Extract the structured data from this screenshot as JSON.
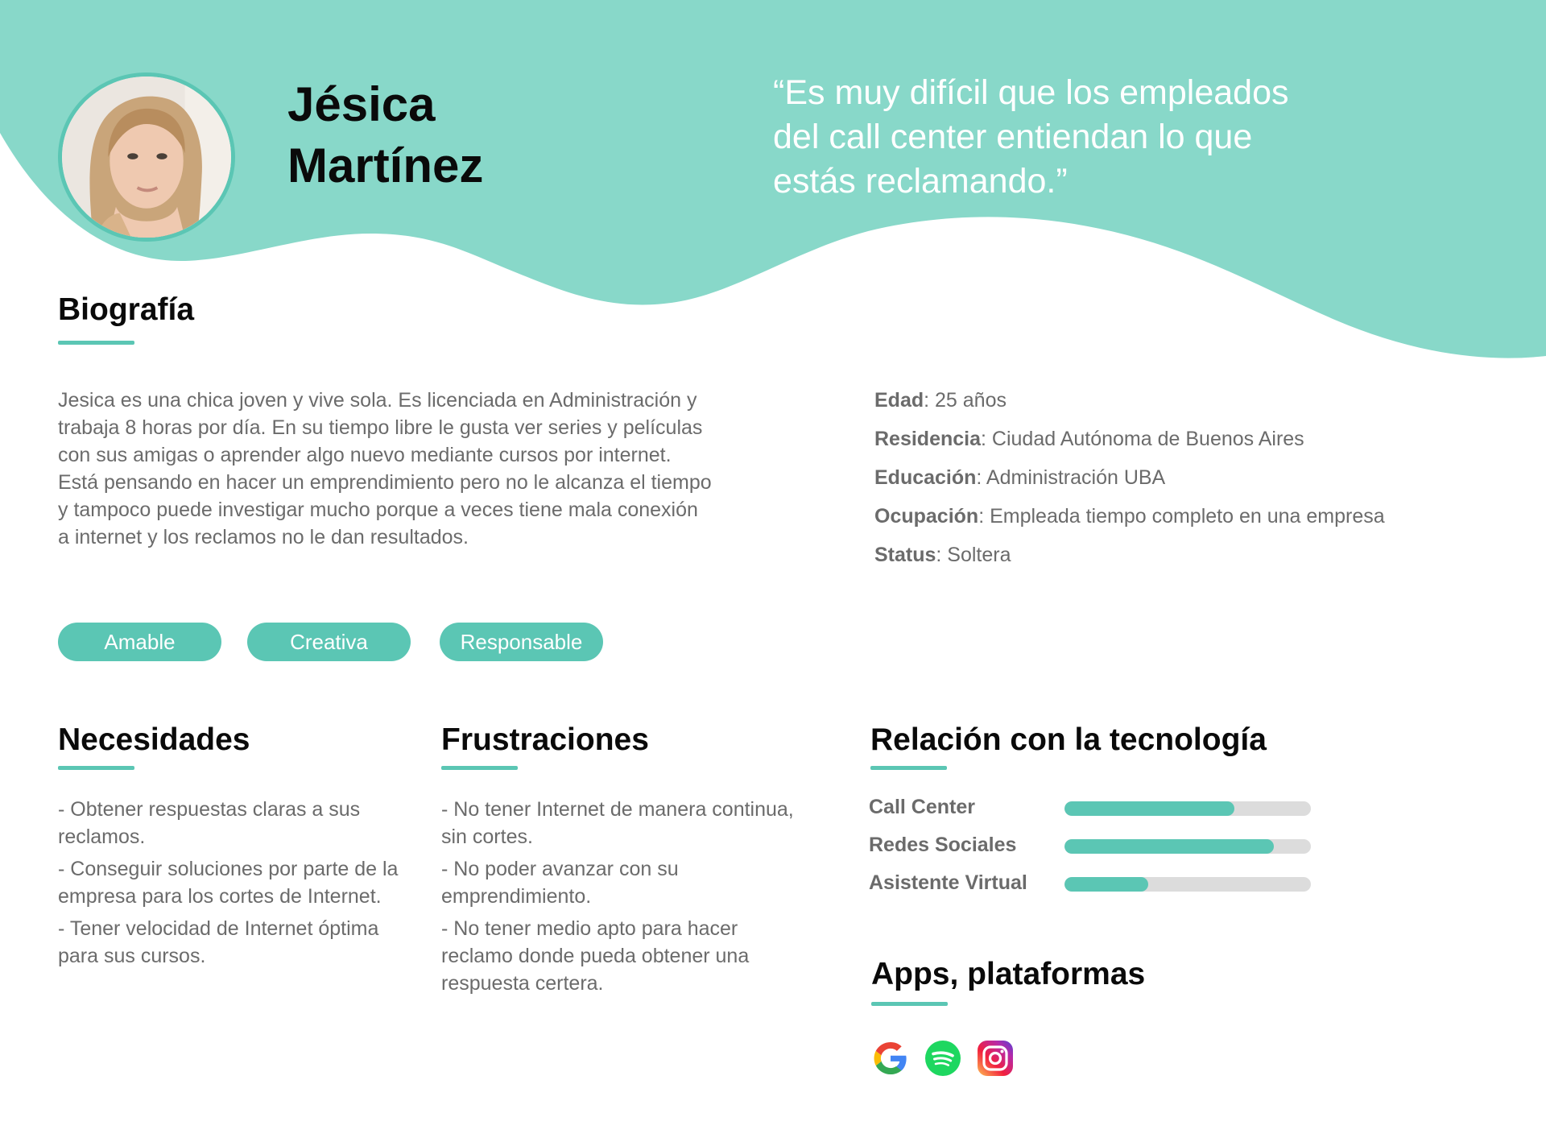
{
  "colors": {
    "accent": "#5bc6b4",
    "wave": "#88d8c9",
    "text_gray": "#6b6b6b"
  },
  "header": {
    "name_line1": "Jésica",
    "name_line2": "Martínez",
    "quote_line1": "“Es muy difícil que los empleados",
    "quote_line2": "del call center entiendan lo que",
    "quote_line3": "estás reclamando.”"
  },
  "biography": {
    "title": "Biografía",
    "lines": [
      "Jesica es una chica joven y vive sola. Es licenciada en Administración y",
      "trabaja 8 horas por día. En su tiempo libre le gusta ver series y películas",
      "con sus amigas o aprender algo nuevo mediante cursos por internet.",
      "Está pensando en hacer un emprendimiento pero no le alcanza el tiempo",
      "y tampoco puede investigar mucho porque a veces tiene mala conexión",
      "a internet y los reclamos no le dan resultados."
    ]
  },
  "facts": [
    {
      "key": "Edad",
      "value": ": 25 años"
    },
    {
      "key": "Residencia",
      "value": ": Ciudad Autónoma de Buenos Aires"
    },
    {
      "key": "Educación",
      "value": ": Administración UBA"
    },
    {
      "key": "Ocupación",
      "value": ": Empleada tiempo completo en una empresa"
    },
    {
      "key": "Status",
      "value": ": Soltera"
    }
  ],
  "tags": [
    "Amable",
    "Creativa",
    "Responsable"
  ],
  "needs": {
    "title": "Necesidades",
    "items": [
      "- Obtener respuestas claras a sus reclamos.",
      "- Conseguir soluciones por parte de la empresa para los cortes de Internet.",
      "- Tener velocidad de Internet óptima para sus cursos."
    ]
  },
  "frustrations": {
    "title": "Frustraciones",
    "items": [
      "- No tener Internet de manera continua, sin cortes.",
      "- No poder avanzar con su emprendimiento.",
      "- No tener medio apto para hacer reclamo donde pueda obtener una respuesta certera."
    ]
  },
  "technology": {
    "title": "Relación con la tecnología",
    "items": [
      {
        "label": "Call Center",
        "level": 0.69
      },
      {
        "label": "Redes Sociales",
        "level": 0.85
      },
      {
        "label": "Asistente Virtual",
        "level": 0.34
      }
    ]
  },
  "apps": {
    "title": "Apps, plataformas",
    "icons": [
      "google-icon",
      "spotify-icon",
      "instagram-icon"
    ]
  }
}
